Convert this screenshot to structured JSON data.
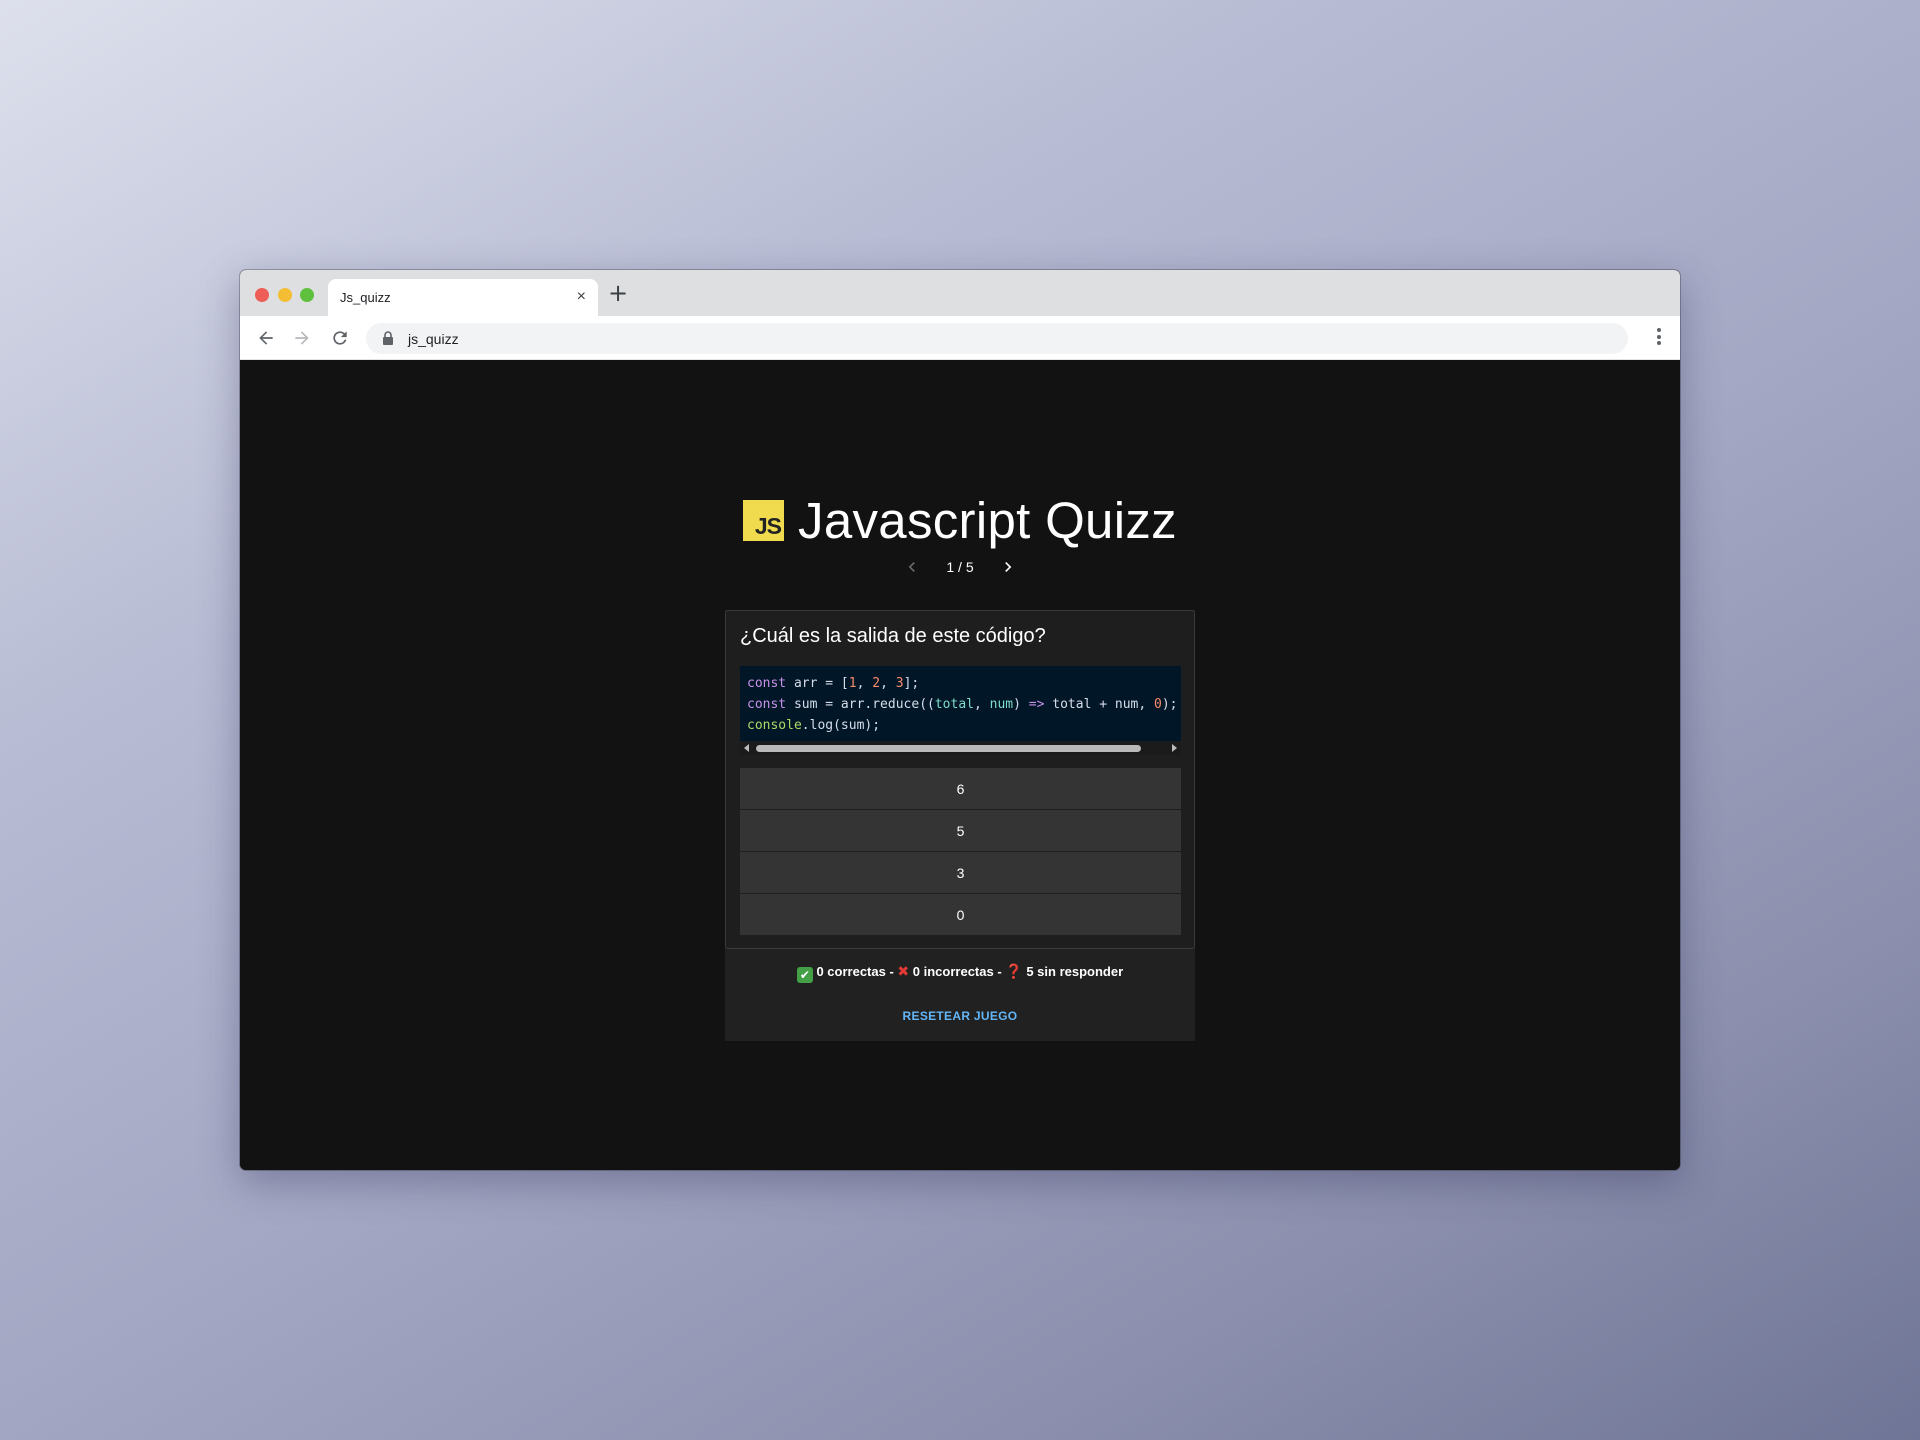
{
  "browser": {
    "tab_title": "Js_quizz",
    "tab_close_icon": "×",
    "new_tab_icon": "+",
    "url": "js_quizz"
  },
  "app": {
    "logo_text": "JS",
    "title": "Javascript Quizz",
    "pager": "1 / 5"
  },
  "question": {
    "title": "¿Cuál es la salida de este código?",
    "answers": [
      "6",
      "5",
      "3",
      "0"
    ]
  },
  "score": {
    "correct": "0 correctas",
    "incorrect": "0 incorrectas",
    "unanswered": "5 sin responder",
    "separator": " - "
  },
  "reset_label": "RESETEAR JUEGO",
  "colors": {
    "page_bg": "#121212",
    "js_yellow": "#f0db4f",
    "link_blue": "#64b5f6",
    "code_bg": "#011627"
  }
}
